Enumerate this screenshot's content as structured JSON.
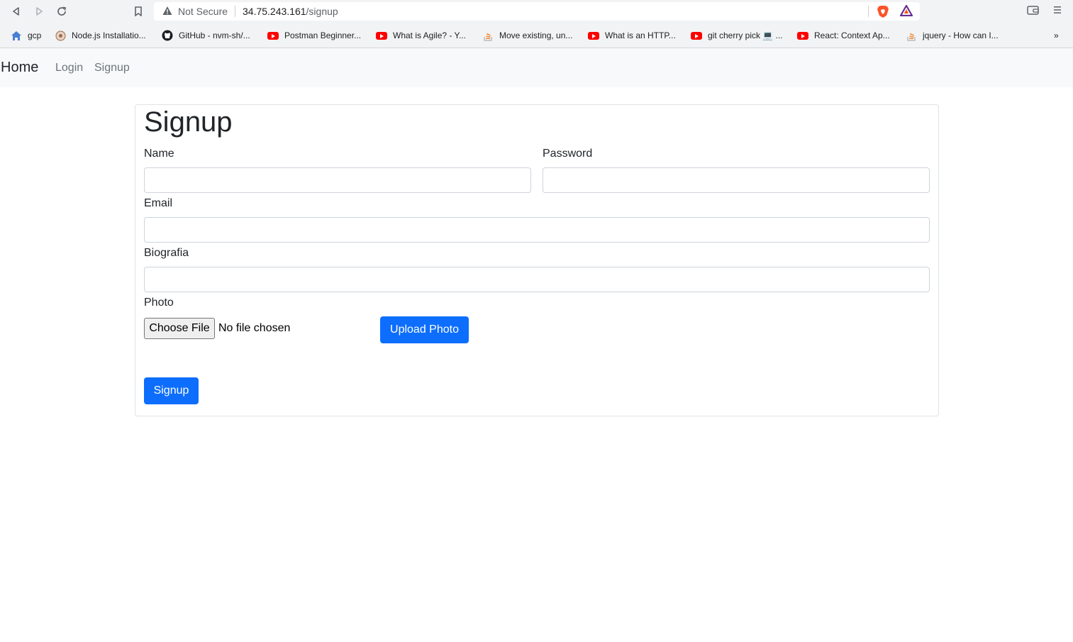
{
  "browser": {
    "security_label": "Not Secure",
    "url_host": "34.75.243.161",
    "url_path": "/signup",
    "bookmarks": [
      {
        "label": "gcp",
        "icon": "home-icon"
      },
      {
        "label": "Node.js Installatio...",
        "icon": "nodejs-icon"
      },
      {
        "label": "GitHub - nvm-sh/...",
        "icon": "github-icon"
      },
      {
        "label": "Postman Beginner...",
        "icon": "youtube-icon"
      },
      {
        "label": "What is Agile? - Y...",
        "icon": "youtube-icon"
      },
      {
        "label": "Move existing, un...",
        "icon": "stackoverflow-icon"
      },
      {
        "label": "What is an HTTP...",
        "icon": "youtube-icon"
      },
      {
        "label": "git cherry pick 💻 ...",
        "icon": "youtube-icon"
      },
      {
        "label": "React: Context Ap...",
        "icon": "youtube-icon"
      },
      {
        "label": "jquery - How can I...",
        "icon": "stackoverflow-icon"
      }
    ],
    "more_label": "»"
  },
  "navbar": {
    "brand": "Home",
    "links": [
      "Login",
      "Signup"
    ]
  },
  "form": {
    "title": "Signup",
    "name_label": "Name",
    "password_label": "Password",
    "email_label": "Email",
    "bio_label": "Biografia",
    "photo_label": "Photo",
    "choose_file_label": "Choose File",
    "no_file_text": "No file chosen",
    "upload_label": "Upload Photo",
    "submit_label": "Signup"
  },
  "colors": {
    "primary": "#0d6efd",
    "navbar_bg": "#f8f9fa",
    "chrome_bg": "#f1f3f4"
  }
}
